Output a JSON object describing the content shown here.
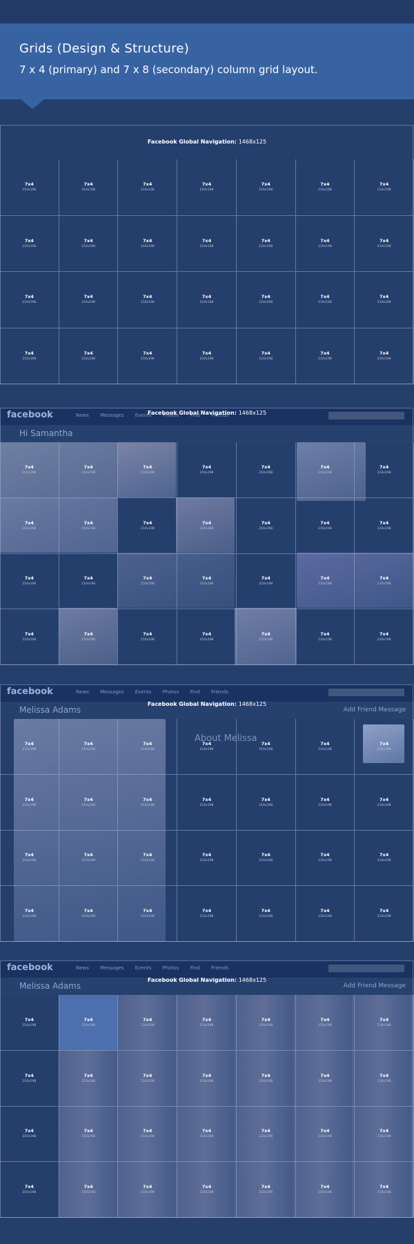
{
  "header": {
    "title": "Grids (Design & Structure)",
    "subtitle": "7 x 4 (primary) and 7 x 8 (secondary) column grid layout."
  },
  "nav_label": {
    "bold": "Facebook Global Navigation:",
    "size": "1468x125"
  },
  "cell": {
    "label": "7x4",
    "size": "210x198"
  },
  "grid": {
    "columns": 7,
    "rows": 4
  },
  "fb": {
    "logo": "facebook",
    "nav_items": "News Messages Events Photos Find Friends",
    "screen1_name": "Hi Samantha",
    "screen2_name": "Melissa Adams",
    "screen2_heading": "About Melissa",
    "screen3_name": "Melissa Adams",
    "screen_actions": "Add Friend   Message"
  },
  "colors": {
    "background": "#253f6d",
    "header": "#3863a3",
    "gridline": "#aabee1"
  }
}
